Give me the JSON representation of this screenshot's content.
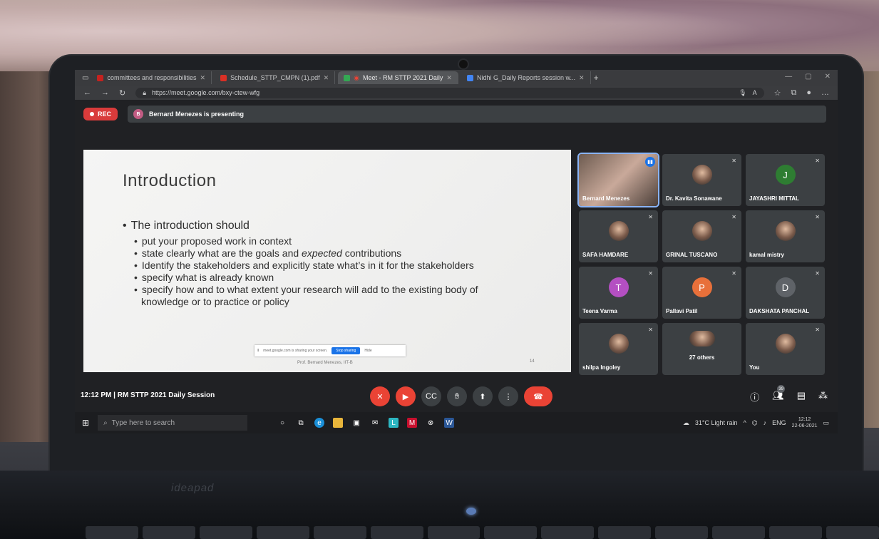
{
  "browser": {
    "tabs": [
      {
        "label": "committees and responsibilities",
        "color": "#c5221f"
      },
      {
        "label": "Schedule_STTP_CMPN (1).pdf",
        "color": "#d93025"
      },
      {
        "label": "Meet - RM STTP 2021 Daily",
        "color": "#34a853",
        "active": true
      },
      {
        "label": "Nidhi G_Daily Reports session w...",
        "color": "#4285f4"
      }
    ],
    "url": "https://meet.google.com/bxy-ctew-wfg"
  },
  "meet": {
    "rec_label": "REC",
    "presenter_initial": "B",
    "presenting_text": "Bernard Menezes is presenting",
    "meeting_time": "12:12 PM",
    "meeting_title": "RM STTP 2021 Daily Session",
    "participants_count": "39"
  },
  "slide": {
    "title": "Introduction",
    "bullet": "The introduction should",
    "sub_bullets": [
      "put your proposed work in context",
      "state clearly what are the goals and expected contributions",
      "Identify the stakeholders and explicitly state what’s in it for the stakeholders",
      "specify what is already known",
      "specify how and to what extent your research will add to the existing body of knowledge or to practice or policy"
    ],
    "share_notice": "meet.google.com is sharing your screen.",
    "stop_sharing": "Stop sharing",
    "hide": "Hide",
    "footer": "Prof. Bernard Menezes, IIT-B",
    "page_number": "14"
  },
  "participants": [
    {
      "name": "Bernard Menezes",
      "type": "photo",
      "speaking": true
    },
    {
      "name": "Dr. Kavita Sonawane",
      "type": "photo"
    },
    {
      "name": "JAYASHRI MITTAL",
      "type": "initial",
      "initial": "J",
      "color": "#2e7d32"
    },
    {
      "name": "SAFA HAMDARE",
      "type": "photo"
    },
    {
      "name": "GRINAL TUSCANO",
      "type": "photo"
    },
    {
      "name": "kamal mistry",
      "type": "photo"
    },
    {
      "name": "Teena Varma",
      "type": "initial",
      "initial": "T",
      "color": "#b44fc2"
    },
    {
      "name": "Pallavi Patil",
      "type": "initial",
      "initial": "P",
      "color": "#e8703a"
    },
    {
      "name": "DAKSHATA PANCHAL",
      "type": "initial",
      "initial": "D",
      "color": "#5f6368"
    },
    {
      "name": "shilpa Ingoley",
      "type": "photo"
    },
    {
      "name": "27 others",
      "type": "group"
    },
    {
      "name": "You",
      "type": "photo"
    }
  ],
  "taskbar": {
    "search_placeholder": "Type here to search",
    "weather": "31°C Light rain",
    "lang": "ENG",
    "time": "12:12",
    "date": "22-06-2021"
  }
}
